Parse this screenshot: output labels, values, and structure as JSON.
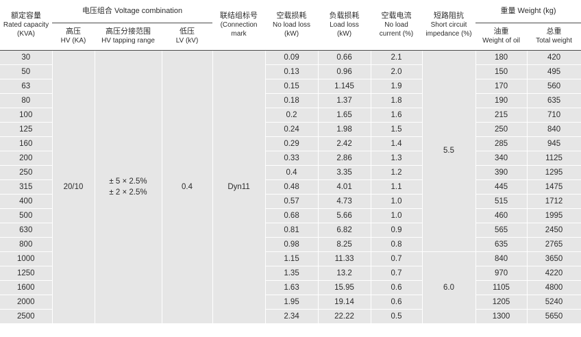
{
  "headers": {
    "capacity": {
      "zh": "额定容量",
      "en1": "Rated capacity",
      "en2": "(KVA)"
    },
    "voltage_group": "电压组合 Voltage combination",
    "hv": {
      "zh": "高压",
      "en": "HV (KA)"
    },
    "tap": {
      "zh": "高压分接范围",
      "en": "HV tapping range"
    },
    "lv": {
      "zh": "低压",
      "en": "LV (kV)"
    },
    "connection": {
      "zh": "联结组标号",
      "en1": "(Connection",
      "en2": "mark"
    },
    "no_load_loss": {
      "zh": "空载损耗",
      "en1": "No load loss",
      "en2": "(kW)"
    },
    "load_loss": {
      "zh": "负载损耗",
      "en1": "Load loss",
      "en2": "(kW)"
    },
    "no_load_current": {
      "zh": "空载电流",
      "en1": "No load",
      "en2": "current (%)"
    },
    "impedance": {
      "zh": "短路阻抗",
      "en1": "Short circuit",
      "en2": "impedance (%)"
    },
    "weight_group": "重量 Weight (kg)",
    "oil": {
      "zh": "油重",
      "en": "Weight of oil"
    },
    "total": {
      "zh": "总重",
      "en": "Total weight"
    }
  },
  "merged": {
    "hv": "20/10",
    "tap_line1": "± 5 × 2.5%",
    "tap_line2": "± 2 × 2.5%",
    "lv": "0.4",
    "connection": "Dyn11",
    "impedance_a": "5.5",
    "impedance_b": "6.0"
  },
  "rows": [
    {
      "capacity": "30",
      "no_load_loss": "0.09",
      "load_loss": "0.66",
      "current": "2.1",
      "oil": "180",
      "total": "420"
    },
    {
      "capacity": "50",
      "no_load_loss": "0.13",
      "load_loss": "0.96",
      "current": "2.0",
      "oil": "150",
      "total": "495"
    },
    {
      "capacity": "63",
      "no_load_loss": "0.15",
      "load_loss": "1.145",
      "current": "1.9",
      "oil": "170",
      "total": "560"
    },
    {
      "capacity": "80",
      "no_load_loss": "0.18",
      "load_loss": "1.37",
      "current": "1.8",
      "oil": "190",
      "total": "635"
    },
    {
      "capacity": "100",
      "no_load_loss": "0.2",
      "load_loss": "1.65",
      "current": "1.6",
      "oil": "215",
      "total": "710"
    },
    {
      "capacity": "125",
      "no_load_loss": "0.24",
      "load_loss": "1.98",
      "current": "1.5",
      "oil": "250",
      "total": "840"
    },
    {
      "capacity": "160",
      "no_load_loss": "0.29",
      "load_loss": "2.42",
      "current": "1.4",
      "oil": "285",
      "total": "945"
    },
    {
      "capacity": "200",
      "no_load_loss": "0.33",
      "load_loss": "2.86",
      "current": "1.3",
      "oil": "340",
      "total": "1125"
    },
    {
      "capacity": "250",
      "no_load_loss": "0.4",
      "load_loss": "3.35",
      "current": "1.2",
      "oil": "390",
      "total": "1295"
    },
    {
      "capacity": "315",
      "no_load_loss": "0.48",
      "load_loss": "4.01",
      "current": "1.1",
      "oil": "445",
      "total": "1475"
    },
    {
      "capacity": "400",
      "no_load_loss": "0.57",
      "load_loss": "4.73",
      "current": "1.0",
      "oil": "515",
      "total": "1712"
    },
    {
      "capacity": "500",
      "no_load_loss": "0.68",
      "load_loss": "5.66",
      "current": "1.0",
      "oil": "460",
      "total": "1995"
    },
    {
      "capacity": "630",
      "no_load_loss": "0.81",
      "load_loss": "6.82",
      "current": "0.9",
      "oil": "565",
      "total": "2450"
    },
    {
      "capacity": "800",
      "no_load_loss": "0.98",
      "load_loss": "8.25",
      "current": "0.8",
      "oil": "635",
      "total": "2765"
    },
    {
      "capacity": "1000",
      "no_load_loss": "1.15",
      "load_loss": "11.33",
      "current": "0.7",
      "oil": "840",
      "total": "3650"
    },
    {
      "capacity": "1250",
      "no_load_loss": "1.35",
      "load_loss": "13.2",
      "current": "0.7",
      "oil": "970",
      "total": "4220"
    },
    {
      "capacity": "1600",
      "no_load_loss": "1.63",
      "load_loss": "15.95",
      "current": "0.6",
      "oil": "1105",
      "total": "4800"
    },
    {
      "capacity": "2000",
      "no_load_loss": "1.95",
      "load_loss": "19.14",
      "current": "0.6",
      "oil": "1205",
      "total": "5240"
    },
    {
      "capacity": "2500",
      "no_load_loss": "2.34",
      "load_loss": "22.22",
      "current": "0.5",
      "oil": "1300",
      "total": "5650"
    }
  ]
}
